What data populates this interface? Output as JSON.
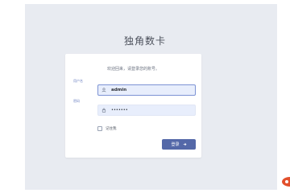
{
  "app": {
    "title": "独角数卡"
  },
  "login": {
    "welcome": "欢迎回来，请登录您的账号。",
    "username_label": "用户名",
    "username_value": "admin",
    "password_label": "密码",
    "password_value": "•••••••",
    "remember_label": "记住我",
    "submit_label": "登录"
  },
  "colors": {
    "page_bg": "#e8ebf1",
    "accent": "#5468a8",
    "input_bg": "#e8eefc",
    "corner_badge": "#e2502c"
  },
  "icons": {
    "username": "user-icon",
    "password": "lock-icon",
    "submit": "arrow-right-icon",
    "corner": "logo-badge-icon"
  }
}
